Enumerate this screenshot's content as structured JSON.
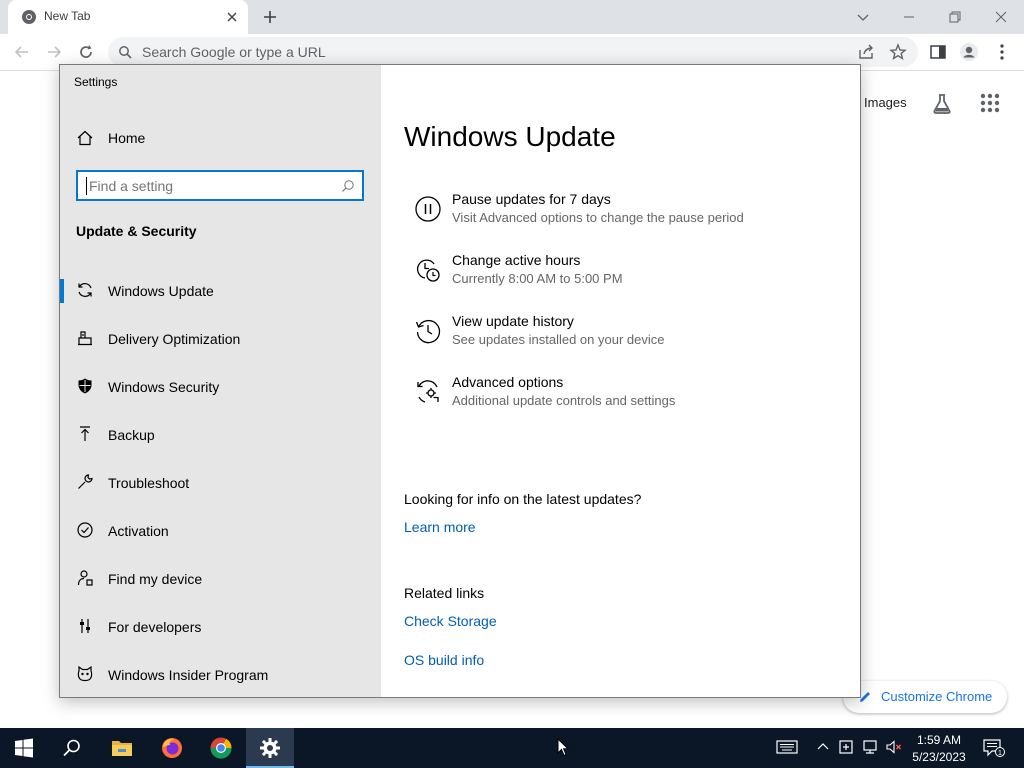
{
  "chrome": {
    "tab_title": "New Tab",
    "omnibox_placeholder": "Search Google or type a URL",
    "images_link": "Images",
    "customize_label": "Customize Chrome"
  },
  "settings": {
    "window_title": "Settings",
    "home_label": "Home",
    "search_placeholder": "Find a setting",
    "section_heading": "Update & Security",
    "nav_items": [
      {
        "label": "Windows Update",
        "icon": "sync-icon",
        "selected": true
      },
      {
        "label": "Delivery Optimization",
        "icon": "delivery-optimization-icon",
        "selected": false
      },
      {
        "label": "Windows Security",
        "icon": "shield-icon",
        "selected": false
      },
      {
        "label": "Backup",
        "icon": "backup-icon",
        "selected": false
      },
      {
        "label": "Troubleshoot",
        "icon": "wrench-icon",
        "selected": false
      },
      {
        "label": "Activation",
        "icon": "check-circle-icon",
        "selected": false
      },
      {
        "label": "Find my device",
        "icon": "person-location-icon",
        "selected": false
      },
      {
        "label": "For developers",
        "icon": "developer-icon",
        "selected": false
      },
      {
        "label": "Windows Insider Program",
        "icon": "insider-cat-icon",
        "selected": false
      }
    ],
    "page_title": "Windows Update",
    "options": [
      {
        "title": "Pause updates for 7 days",
        "subtitle": "Visit Advanced options to change the pause period",
        "icon": "pause-circle-icon"
      },
      {
        "title": "Change active hours",
        "subtitle": "Currently 8:00 AM to 5:00 PM",
        "icon": "active-hours-clock-icon"
      },
      {
        "title": "View update history",
        "subtitle": "See updates installed on your device",
        "icon": "history-icon"
      },
      {
        "title": "Advanced options",
        "subtitle": "Additional update controls and settings",
        "icon": "advanced-sync-gear-icon"
      }
    ],
    "info_question": "Looking for info on the latest updates?",
    "learn_more": "Learn more",
    "related_heading": "Related links",
    "related_links": [
      "Check Storage",
      "OS build info"
    ]
  },
  "taskbar": {
    "time": "1:59 AM",
    "date": "5/23/2023",
    "notification_count": "1",
    "apps": [
      "start-icon",
      "search-icon",
      "file-explorer-icon",
      "firefox-icon",
      "chrome-icon",
      "settings-gear-icon"
    ]
  },
  "colors": {
    "accent": "#0078d4",
    "link": "#005fb8",
    "taskbar": "#0b1626",
    "settings_sidebar": "#e6e6e6"
  }
}
